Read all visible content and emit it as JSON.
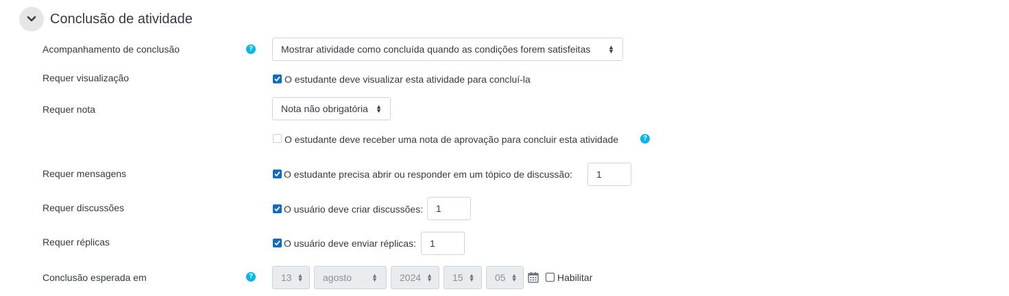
{
  "section": {
    "title": "Conclusão de atividade"
  },
  "rows": {
    "tracking": {
      "label": "Acompanhamento de conclusão",
      "select_value": "Mostrar atividade como concluída quando as condições forem satisfeitas"
    },
    "view": {
      "label": "Requer visualização",
      "checkbox_text": "O estudante deve visualizar esta atividade para concluí-la"
    },
    "grade": {
      "label": "Requer nota",
      "select_value": "Nota não obrigatória",
      "pass_text": "O estudante deve receber uma nota de aprovação para concluir esta atividade"
    },
    "posts": {
      "label": "Requer mensagens",
      "checkbox_text": "O estudante precisa abrir ou responder em um tópico de discussão:",
      "value": "1"
    },
    "discussions": {
      "label": "Requer discussões",
      "checkbox_text": "O usuário deve criar discussões:",
      "value": "1"
    },
    "replies": {
      "label": "Requer réplicas",
      "checkbox_text": "O usuário deve enviar réplicas:",
      "value": "1"
    },
    "expected": {
      "label": "Conclusão esperada em",
      "day": "13",
      "month": "agosto",
      "year": "2024",
      "hour": "15",
      "minute": "05",
      "enable_text": "Habilitar"
    }
  },
  "icons": {
    "help": "?"
  },
  "colors": {
    "accent": "#0f6cbf",
    "help": "#0fb4e6"
  }
}
